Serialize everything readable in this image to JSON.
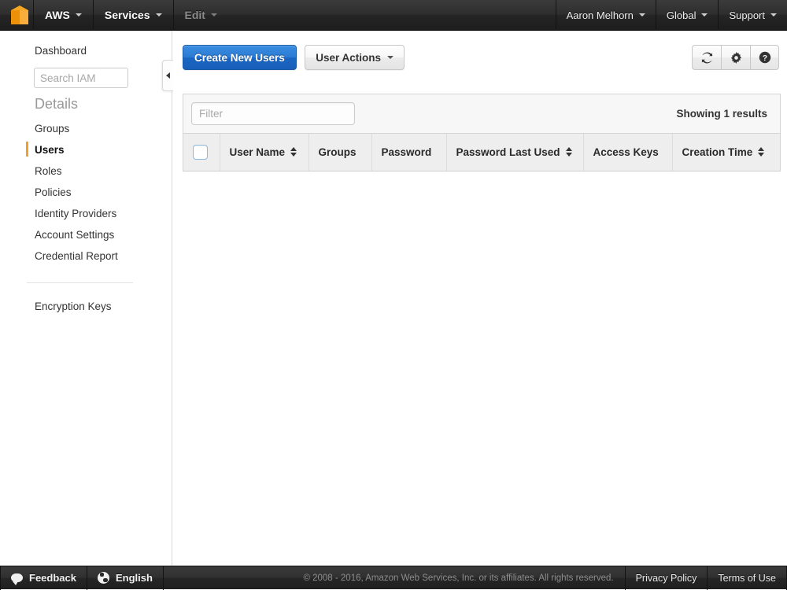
{
  "topnav": {
    "logo_icon": "aws-cube-logo",
    "items": [
      {
        "label": "AWS",
        "dimmed": false
      },
      {
        "label": "Services",
        "dimmed": false
      },
      {
        "label": "Edit",
        "dimmed": true
      }
    ],
    "right_items": [
      {
        "label": "Aaron Melhorn"
      },
      {
        "label": "Global"
      },
      {
        "label": "Support"
      }
    ]
  },
  "sidebar": {
    "dashboard_label": "Dashboard",
    "search": {
      "placeholder": "Search IAM",
      "value": ""
    },
    "details_header": "Details",
    "items": [
      {
        "label": "Groups",
        "active": false
      },
      {
        "label": "Users",
        "active": true
      },
      {
        "label": "Roles",
        "active": false
      },
      {
        "label": "Policies",
        "active": false
      },
      {
        "label": "Identity Providers",
        "active": false
      },
      {
        "label": "Account Settings",
        "active": false
      },
      {
        "label": "Credential Report",
        "active": false
      }
    ],
    "encryption_label": "Encryption Keys",
    "collapse_icon": "chevron-left-icon"
  },
  "toolbar": {
    "create_label": "Create New Users",
    "user_actions_label": "User Actions",
    "icon_buttons": [
      {
        "name": "refresh-icon",
        "glyph": "↻"
      },
      {
        "name": "gear-icon",
        "glyph": "⚙"
      },
      {
        "name": "help-icon",
        "glyph": "?"
      }
    ]
  },
  "table": {
    "filter": {
      "placeholder": "Filter",
      "value": ""
    },
    "showing_results": "Showing 1 results",
    "select_all_checked": false,
    "columns": [
      {
        "label": "",
        "sortable": false,
        "kind": "checkbox"
      },
      {
        "label": "User Name",
        "sortable": true
      },
      {
        "label": "Groups",
        "sortable": false
      },
      {
        "label": "Password",
        "sortable": false
      },
      {
        "label": "Password Last Used",
        "sortable": true
      },
      {
        "label": "Access Keys",
        "sortable": false
      },
      {
        "label": "Creation Time",
        "sortable": true
      }
    ],
    "rows": []
  },
  "footer": {
    "feedback_label": "Feedback",
    "language_label": "English",
    "copyright": "© 2008 - 2016, Amazon Web Services, Inc. or its affiliates. All rights reserved.",
    "privacy_label": "Privacy Policy",
    "terms_label": "Terms of Use"
  },
  "colors": {
    "accent_blue": "#2a7ad4",
    "brand_orange": "#f0a030",
    "nav_dark": "#2e2e2e"
  }
}
